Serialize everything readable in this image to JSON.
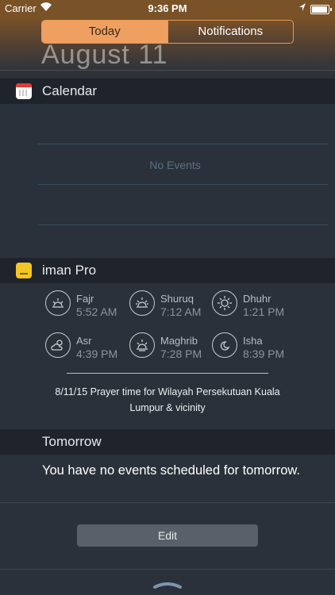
{
  "status_bar": {
    "carrier": "Carrier",
    "time": "9:36 PM",
    "battery_level": 0.95
  },
  "header": {
    "date_partial": "August 11",
    "tabs": [
      {
        "label": "Today",
        "active": true
      },
      {
        "label": "Notifications",
        "active": false
      }
    ]
  },
  "calendar": {
    "title": "Calendar",
    "empty_text": "No Events"
  },
  "iman": {
    "title": "iman Pro",
    "prayers": [
      {
        "name": "Fajr",
        "time": "5:52 AM",
        "icon": "fajr-sunrise-icon"
      },
      {
        "name": "Shuruq",
        "time": "7:12 AM",
        "icon": "shuruq-sunrise-icon"
      },
      {
        "name": "Dhuhr",
        "time": "1:21 PM",
        "icon": "dhuhr-sun-icon"
      },
      {
        "name": "Asr",
        "time": "4:39 PM",
        "icon": "asr-cloud-sun-icon"
      },
      {
        "name": "Maghrib",
        "time": "7:28 PM",
        "icon": "maghrib-sunset-icon"
      },
      {
        "name": "Isha",
        "time": "8:39 PM",
        "icon": "isha-moon-icon"
      }
    ],
    "caption": "8/11/15 Prayer time for Wilayah Persekutuan Kuala Lumpur & vicinity"
  },
  "tomorrow": {
    "title": "Tomorrow",
    "text": "You have no events scheduled for tomorrow."
  },
  "edit_label": "Edit"
}
